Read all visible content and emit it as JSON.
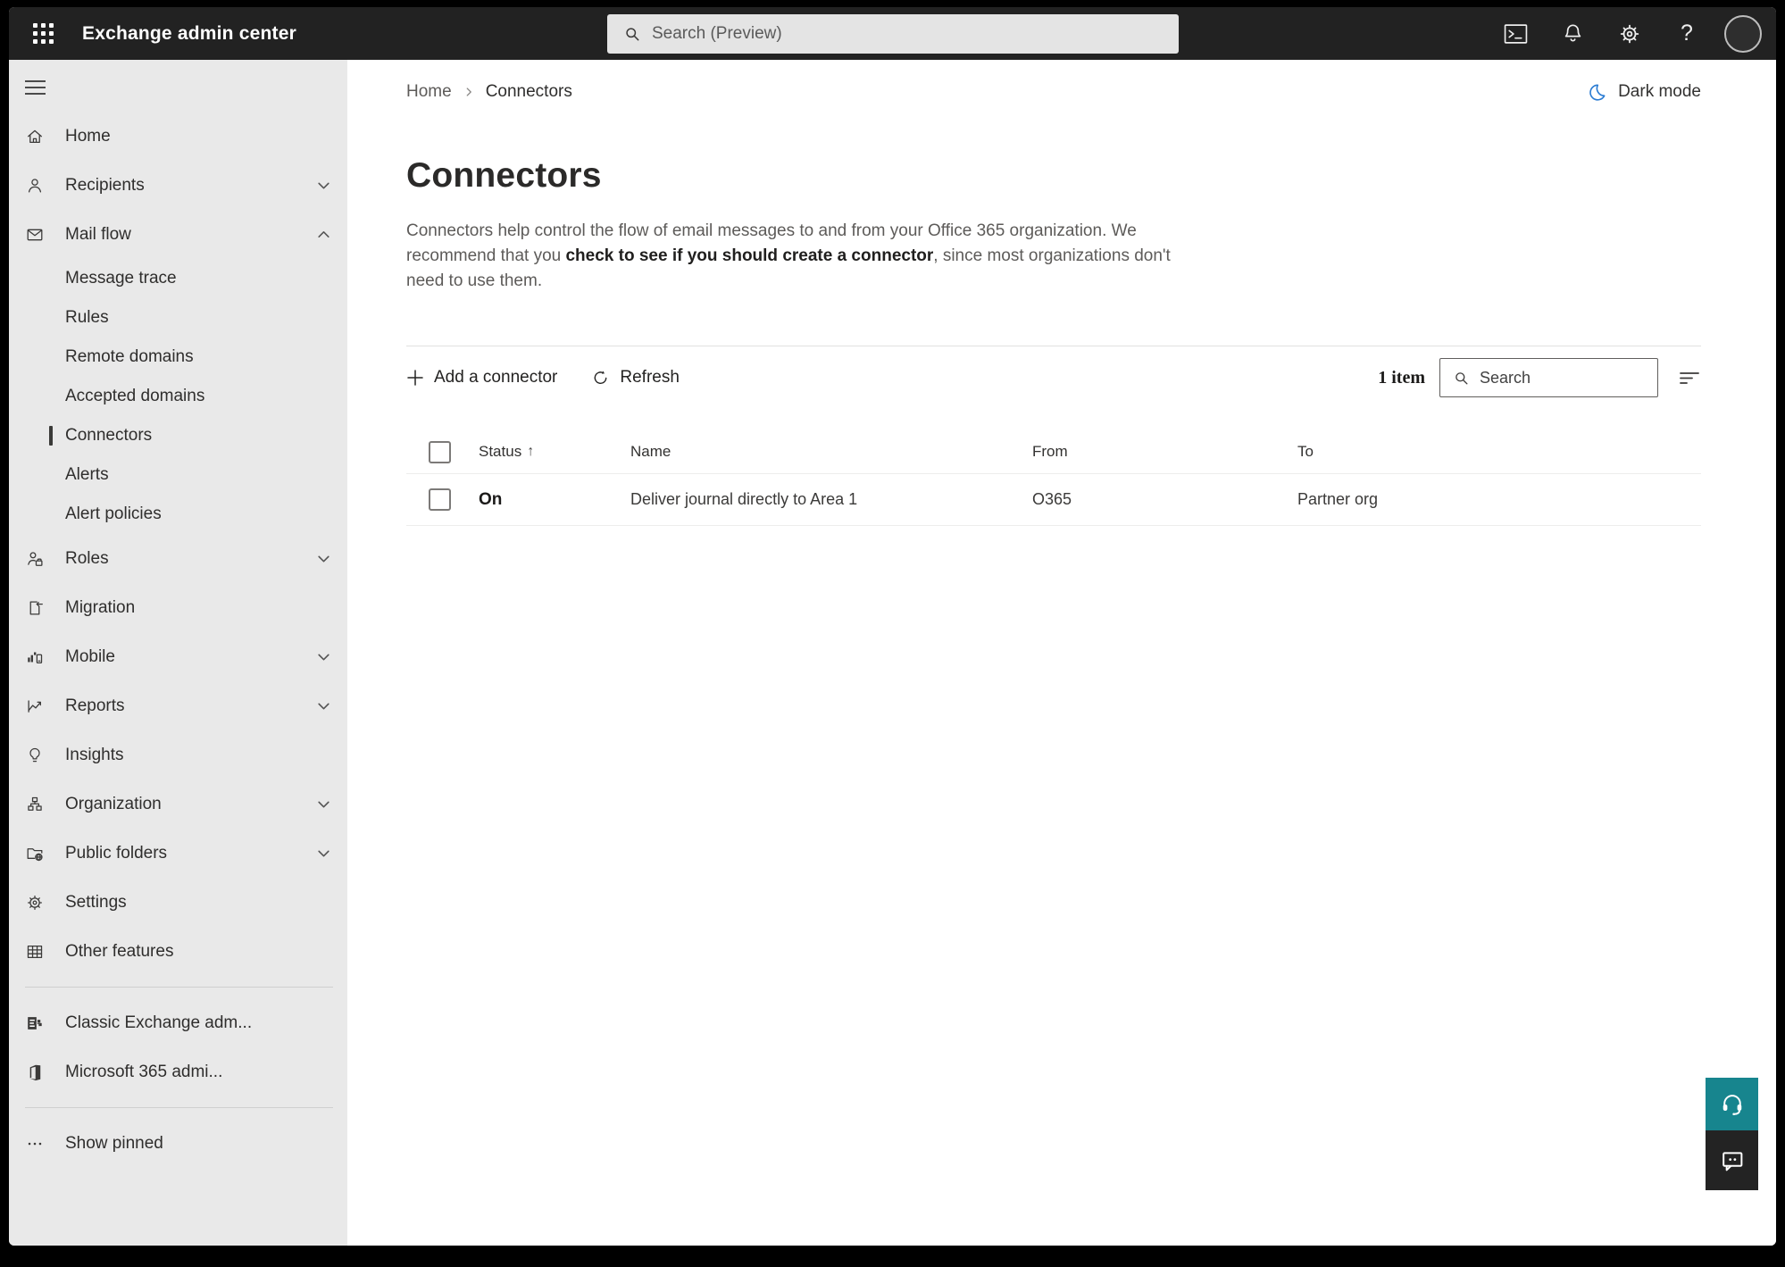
{
  "topbar": {
    "title": "Exchange admin center",
    "search_placeholder": "Search (Preview)",
    "help_glyph": "?"
  },
  "breadcrumb": {
    "items": [
      "Home",
      "Connectors"
    ]
  },
  "dark_mode_label": "Dark mode",
  "page": {
    "title": "Connectors",
    "description_1": "Connectors help control the flow of email messages to and from your Office 365 organization. We recommend that you ",
    "description_link": "check to see if you should create a connector",
    "description_2": ", since most organizations don't need to use them."
  },
  "toolbar": {
    "add_label": "Add a connector",
    "refresh_label": "Refresh",
    "item_count": "1 item",
    "search_placeholder": "Search"
  },
  "table": {
    "columns": [
      "Status",
      "Name",
      "From",
      "To"
    ],
    "sort_indicator": "↑",
    "rows": [
      {
        "status": "On",
        "name": "Deliver journal directly to Area 1",
        "from": "O365",
        "to": "Partner org"
      }
    ]
  },
  "sidebar": {
    "items": [
      {
        "label": "Home"
      },
      {
        "label": "Recipients"
      },
      {
        "label": "Mail flow"
      },
      {
        "label": "Message trace"
      },
      {
        "label": "Rules"
      },
      {
        "label": "Remote domains"
      },
      {
        "label": "Accepted domains"
      },
      {
        "label": "Connectors"
      },
      {
        "label": "Alerts"
      },
      {
        "label": "Alert policies"
      },
      {
        "label": "Roles"
      },
      {
        "label": "Migration"
      },
      {
        "label": "Mobile"
      },
      {
        "label": "Reports"
      },
      {
        "label": "Insights"
      },
      {
        "label": "Organization"
      },
      {
        "label": "Public folders"
      },
      {
        "label": "Settings"
      },
      {
        "label": "Other features"
      },
      {
        "label": "Classic Exchange adm..."
      },
      {
        "label": "Microsoft 365 admi..."
      },
      {
        "label": "Show pinned"
      }
    ]
  },
  "colors": {
    "topbar_bg": "#222222",
    "sidebar_bg": "#e9e9e9",
    "accent_teal": "#17858e",
    "feedback_dark": "#232323",
    "moon_blue": "#2b7cd3"
  }
}
